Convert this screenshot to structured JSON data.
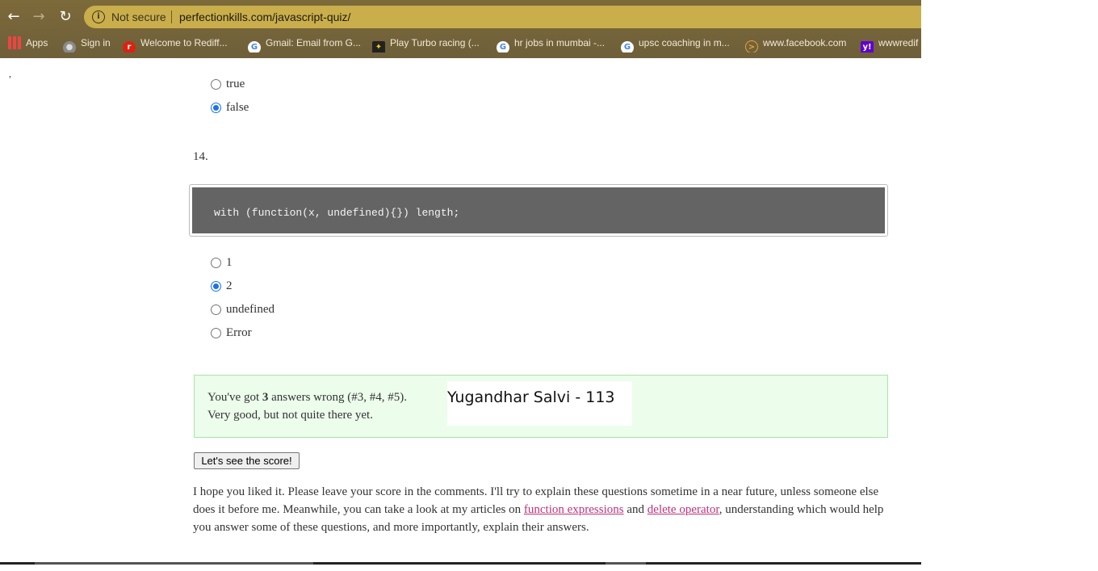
{
  "browser": {
    "security_label": "Not secure",
    "url": "perfectionkills.com/javascript-quiz/",
    "bookmarks": [
      {
        "label": "Apps",
        "icon": "apps-grid-icon"
      },
      {
        "label": "Sign in",
        "icon": "globe-icon"
      },
      {
        "label": "Welcome to Rediff...",
        "icon": "rediff-icon"
      },
      {
        "label": "Gmail: Email from G...",
        "icon": "google-icon"
      },
      {
        "label": "Play Turbo racing (...",
        "icon": "turbo-racing-icon"
      },
      {
        "label": "hr jobs in mumbai -...",
        "icon": "google-icon"
      },
      {
        "label": "upsc coaching in m...",
        "icon": "google-icon"
      },
      {
        "label": "www.facebook.com",
        "icon": "facebook-site-icon"
      },
      {
        "label": "wwwredif",
        "icon": "yahoo-icon"
      }
    ]
  },
  "page": {
    "stray_mark": ",",
    "question13": {
      "options": [
        {
          "label": "true",
          "checked": false
        },
        {
          "label": "false",
          "checked": true
        }
      ]
    },
    "question14": {
      "number": "14.",
      "code": "with (function(x, undefined){}) length;",
      "options": [
        {
          "label": "1",
          "checked": false
        },
        {
          "label": "2",
          "checked": true
        },
        {
          "label": "undefined",
          "checked": false
        },
        {
          "label": "Error",
          "checked": false
        }
      ]
    },
    "result": {
      "prefix": "You've got",
      "count": "3",
      "suffix": "answers wrong (#3, #4, #5).",
      "line2": "Very good, but not quite there yet.",
      "name_overlay": "Yugandhar Salvi - 113"
    },
    "score_button": "Let's see the score!",
    "outro": {
      "text1": "I hope you liked it. Please leave your score in the comments. I'll try to explain these questions sometime in a near future, unless someone else does it before me. Meanwhile, you can take a look at my articles on",
      "link1": "function expressions",
      "text2": "and",
      "link2": "delete operator",
      "text3": ", understanding which would help you answer some of these questions, and more importantly, explain their answers."
    }
  }
}
